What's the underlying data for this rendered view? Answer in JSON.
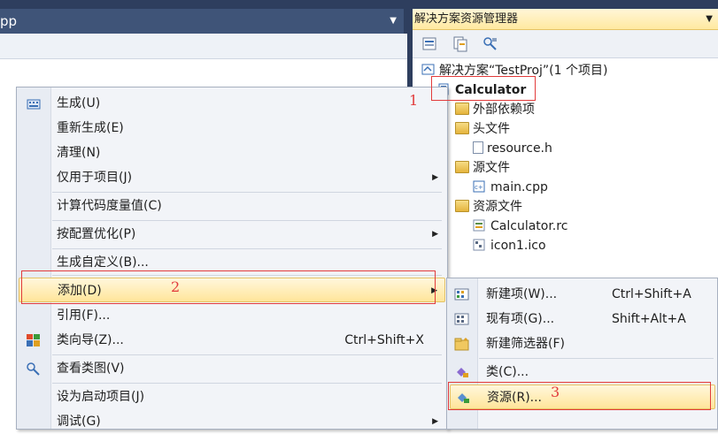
{
  "editor": {
    "tab_label": "pp",
    "dropdown_icon": "chevron-down-icon"
  },
  "solution_explorer": {
    "title": "解决方案资源管理器",
    "tree": [
      {
        "label": "解决方案“TestProj”(1 个项目)",
        "icon": "solution-icon"
      },
      {
        "label": "Calculator",
        "icon": "project-icon"
      },
      {
        "label": "外部依赖项",
        "icon": "folder-icon"
      },
      {
        "label": "头文件",
        "icon": "folder-icon"
      },
      {
        "label": "resource.h",
        "icon": "header-file-icon"
      },
      {
        "label": "源文件",
        "icon": "folder-icon"
      },
      {
        "label": "main.cpp",
        "icon": "cpp-file-icon"
      },
      {
        "label": "资源文件",
        "icon": "folder-icon"
      },
      {
        "label": "Calculator.rc",
        "icon": "rc-file-icon"
      },
      {
        "label": "icon1.ico",
        "icon": "ico-file-icon"
      }
    ]
  },
  "context_menu": {
    "items": [
      {
        "label": "生成(U)",
        "shortcut": "",
        "icon": "build-icon"
      },
      {
        "label": "重新生成(E)",
        "shortcut": ""
      },
      {
        "label": "清理(N)",
        "shortcut": ""
      },
      {
        "label": "仅用于项目(J)",
        "shortcut": "",
        "submenu": true
      },
      {
        "label": "计算代码度量值(C)",
        "shortcut": ""
      },
      {
        "label": "按配置优化(P)",
        "shortcut": "",
        "submenu": true
      },
      {
        "label": "生成自定义(B)...",
        "shortcut": ""
      },
      {
        "label": "添加(D)",
        "shortcut": "",
        "submenu": true,
        "highlighted": true
      },
      {
        "label": "引用(F)...",
        "shortcut": ""
      },
      {
        "label": "类向导(Z)...",
        "shortcut": "Ctrl+Shift+X",
        "icon": "class-wizard-icon"
      },
      {
        "label": "查看类图(V)",
        "shortcut": "",
        "icon": "class-diagram-icon"
      },
      {
        "label": "设为启动项目(J)",
        "shortcut": ""
      },
      {
        "label": "调试(G)",
        "shortcut": "",
        "submenu": true
      }
    ]
  },
  "add_submenu": {
    "items": [
      {
        "label": "新建项(W)...",
        "shortcut": "Ctrl+Shift+A",
        "icon": "new-item-icon"
      },
      {
        "label": "现有项(G)...",
        "shortcut": "Shift+Alt+A",
        "icon": "existing-item-icon"
      },
      {
        "label": "新建筛选器(F)",
        "shortcut": "",
        "icon": "new-filter-icon"
      },
      {
        "label": "类(C)...",
        "shortcut": "",
        "icon": "class-icon"
      },
      {
        "label": "资源(R)...",
        "shortcut": "",
        "icon": "resource-icon",
        "highlighted": true
      }
    ]
  },
  "annotations": {
    "one": "1",
    "two": "2",
    "three": "3"
  },
  "colors": {
    "annotation": "#e23b3b",
    "highlight": "#ffe59a",
    "title_bar": "#2e3e5e"
  }
}
